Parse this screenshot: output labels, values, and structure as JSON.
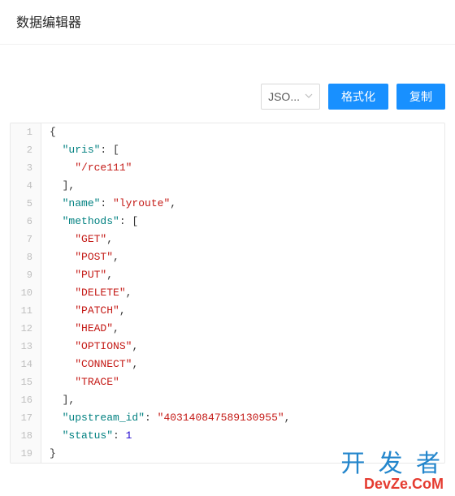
{
  "header": {
    "title": "数据编辑器"
  },
  "toolbar": {
    "format_select": "JSO...",
    "format_button": "格式化",
    "copy_button": "复制"
  },
  "code": {
    "lines": [
      {
        "n": 1,
        "indent": 0,
        "tokens": [
          {
            "t": "{",
            "c": "punc"
          }
        ]
      },
      {
        "n": 2,
        "indent": 1,
        "tokens": [
          {
            "t": "\"uris\"",
            "c": "key"
          },
          {
            "t": ": [",
            "c": "punc"
          }
        ]
      },
      {
        "n": 3,
        "indent": 2,
        "tokens": [
          {
            "t": "\"/rce111\"",
            "c": "str"
          }
        ]
      },
      {
        "n": 4,
        "indent": 1,
        "tokens": [
          {
            "t": "],",
            "c": "punc"
          }
        ]
      },
      {
        "n": 5,
        "indent": 1,
        "tokens": [
          {
            "t": "\"name\"",
            "c": "key"
          },
          {
            "t": ": ",
            "c": "punc"
          },
          {
            "t": "\"lyroute\"",
            "c": "str"
          },
          {
            "t": ",",
            "c": "punc"
          }
        ]
      },
      {
        "n": 6,
        "indent": 1,
        "tokens": [
          {
            "t": "\"methods\"",
            "c": "key"
          },
          {
            "t": ": [",
            "c": "punc"
          }
        ]
      },
      {
        "n": 7,
        "indent": 2,
        "tokens": [
          {
            "t": "\"GET\"",
            "c": "str"
          },
          {
            "t": ",",
            "c": "punc"
          }
        ]
      },
      {
        "n": 8,
        "indent": 2,
        "tokens": [
          {
            "t": "\"POST\"",
            "c": "str"
          },
          {
            "t": ",",
            "c": "punc"
          }
        ]
      },
      {
        "n": 9,
        "indent": 2,
        "tokens": [
          {
            "t": "\"PUT\"",
            "c": "str"
          },
          {
            "t": ",",
            "c": "punc"
          }
        ]
      },
      {
        "n": 10,
        "indent": 2,
        "tokens": [
          {
            "t": "\"DELETE\"",
            "c": "str"
          },
          {
            "t": ",",
            "c": "punc"
          }
        ]
      },
      {
        "n": 11,
        "indent": 2,
        "tokens": [
          {
            "t": "\"PATCH\"",
            "c": "str"
          },
          {
            "t": ",",
            "c": "punc"
          }
        ]
      },
      {
        "n": 12,
        "indent": 2,
        "tokens": [
          {
            "t": "\"HEAD\"",
            "c": "str"
          },
          {
            "t": ",",
            "c": "punc"
          }
        ]
      },
      {
        "n": 13,
        "indent": 2,
        "tokens": [
          {
            "t": "\"OPTIONS\"",
            "c": "str"
          },
          {
            "t": ",",
            "c": "punc"
          }
        ]
      },
      {
        "n": 14,
        "indent": 2,
        "tokens": [
          {
            "t": "\"CONNECT\"",
            "c": "str"
          },
          {
            "t": ",",
            "c": "punc"
          }
        ]
      },
      {
        "n": 15,
        "indent": 2,
        "tokens": [
          {
            "t": "\"TRACE\"",
            "c": "str"
          }
        ]
      },
      {
        "n": 16,
        "indent": 1,
        "tokens": [
          {
            "t": "],",
            "c": "punc"
          }
        ]
      },
      {
        "n": 17,
        "indent": 1,
        "tokens": [
          {
            "t": "\"upstream_id\"",
            "c": "key"
          },
          {
            "t": ": ",
            "c": "punc"
          },
          {
            "t": "\"403140847589130955\"",
            "c": "str"
          },
          {
            "t": ",",
            "c": "punc"
          }
        ]
      },
      {
        "n": 18,
        "indent": 1,
        "tokens": [
          {
            "t": "\"status\"",
            "c": "key"
          },
          {
            "t": ": ",
            "c": "punc"
          },
          {
            "t": "1",
            "c": "num"
          }
        ]
      },
      {
        "n": 19,
        "indent": 0,
        "tokens": [
          {
            "t": "}",
            "c": "punc"
          }
        ]
      }
    ]
  },
  "watermark": {
    "big": "开 发 者",
    "sub": "DevZe.CoM"
  }
}
